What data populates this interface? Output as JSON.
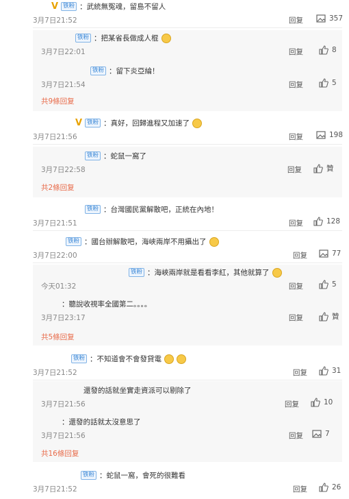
{
  "comments": [
    {
      "text": "：武統無冤魂，留島不留人",
      "time": "3月7日21:52",
      "reply": "回复",
      "count": "357",
      "icon": "image-icon"
    },
    {
      "text": "：把某省長做成人棍",
      "time": "3月7日22:01",
      "reply": "回复",
      "count": "8",
      "icon": "thumb-icon"
    },
    {
      "text": "：留下炎亞綸！",
      "time": "3月7日21:54",
      "reply": "回复",
      "count": "5",
      "icon": "thumb-icon"
    },
    {
      "text": "共9條回复"
    },
    {
      "text": "：真好，回歸進程又加速了",
      "time": "3月7日21:56",
      "reply": "回复",
      "count": "198",
      "icon": "image-icon"
    },
    {
      "text": "：蛇鼠一窩了",
      "time": "3月7日22:58",
      "reply": "回复",
      "count": "贊",
      "icon": "thumb-icon"
    },
    {
      "text": "共2條回复"
    },
    {
      "text": "：台灣國民黨解散吧，正統在內地！",
      "time": "3月7日21:51",
      "reply": "回复",
      "count": "128",
      "icon": "thumb-icon"
    },
    {
      "text": "：國台辦解散吧，海峽兩岸不用攝出了",
      "time": "3月7日22:00",
      "reply": "回复",
      "count": "77",
      "icon": "image-icon"
    },
    {
      "text": "：海峽兩岸就是看看李紅，其他就算了",
      "time": "今天01:32",
      "reply": "回复",
      "count": "5",
      "icon": "thumb-icon"
    },
    {
      "text": "：聽說收視率全國第二。。。。",
      "time": "3月7日23:17",
      "reply": "回复",
      "count": "贊",
      "icon": "thumb-icon"
    },
    {
      "text": "共5條回复"
    },
    {
      "text": "：不知道會不會發貸電",
      "time": "3月7日21:52",
      "reply": "回复",
      "count": "31",
      "icon": "thumb-icon"
    },
    {
      "text": "還發的話就坐實走資派可以剔除了",
      "time": "3月7日21:56",
      "reply": "回复",
      "count": "10",
      "icon": "thumb-icon"
    },
    {
      "text": "：還發的話就太沒意思了",
      "time": "3月7日21:56",
      "reply": "回复",
      "count": "7",
      "icon": "image-icon"
    },
    {
      "text": "共16條回复"
    },
    {
      "text": "：蛇鼠一窩，會死的很難看",
      "time": "3月7日21:52",
      "reply": "回复",
      "count": "26",
      "icon": "thumb-icon"
    }
  ],
  "fan_label": "铁粉"
}
